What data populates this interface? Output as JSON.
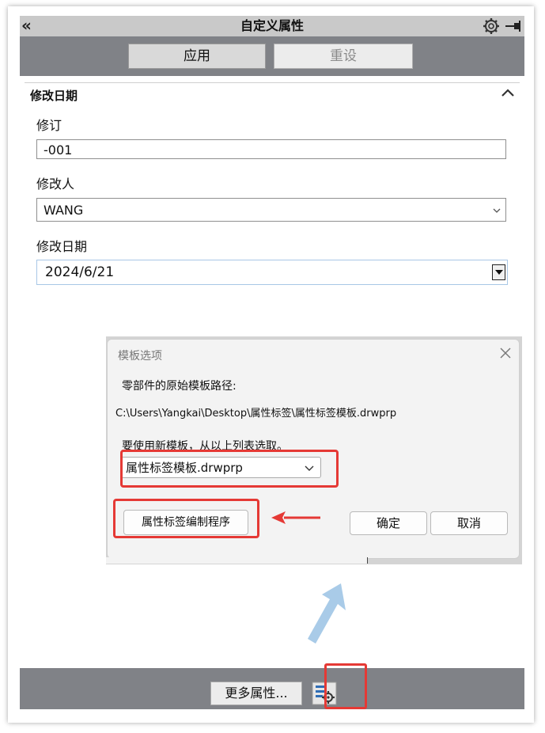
{
  "panel": {
    "title": "自定义属性",
    "collapse_glyph": "«",
    "apply_label": "应用",
    "reset_label": "重设",
    "section_title": "修改日期",
    "fields": {
      "revision_label": "修订",
      "revision_value": "-001",
      "modifier_label": "修改人",
      "modifier_value": "WANG",
      "date_label": "修改日期",
      "date_value": "2024/6/21"
    },
    "more_props_label": "更多属性...",
    "icons": [
      "collapse-icon",
      "gear-icon",
      "pin-icon",
      "chevron-up-icon",
      "chevron-down-icon",
      "properties-settings-icon"
    ]
  },
  "dialog": {
    "title": "模板选项",
    "original_path_label": "零部件的原始模板路径:",
    "original_path": "C:\\Users\\Yangkai\\Desktop\\属性标签\\属性标签模板.drwprp",
    "new_template_label": "要使用新模板，从以上列表选取。",
    "template_select_value": "属性标签模板.drwprp",
    "editor_button": "属性标签编制程序",
    "ok_button": "确定",
    "cancel_button": "取消"
  },
  "annotation_colors": {
    "highlight": "#e53935",
    "arrow_red": "#e53935",
    "arrow_blue": "#a9cbe8"
  }
}
